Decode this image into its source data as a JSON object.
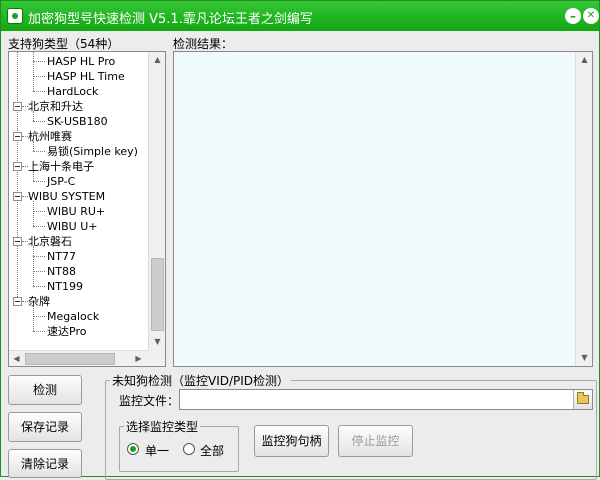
{
  "app": {
    "title": "加密狗型号快速检测 V5.1.霏凡论坛王者之剑编写",
    "minimize_glyph": "–",
    "close_glyph": "✕"
  },
  "tree": {
    "label": "支持狗类型（54种）",
    "rows": [
      {
        "text": "HASP HL Pro",
        "level": 1
      },
      {
        "text": "HASP HL Time",
        "level": 1
      },
      {
        "text": "HardLock",
        "level": 1
      },
      {
        "text": "北京和升达",
        "level": 0
      },
      {
        "text": "SK-USB180",
        "level": 1
      },
      {
        "text": "杭州唯赛",
        "level": 0
      },
      {
        "text": "易锁(Simple key)",
        "level": 1
      },
      {
        "text": "上海十条电子",
        "level": 0
      },
      {
        "text": "JSP-C",
        "level": 1
      },
      {
        "text": "WIBU SYSTEM",
        "level": 0
      },
      {
        "text": "WIBU RU+",
        "level": 1
      },
      {
        "text": "WIBU U+",
        "level": 1
      },
      {
        "text": "北京磐石",
        "level": 0
      },
      {
        "text": "NT77",
        "level": 1
      },
      {
        "text": "NT88",
        "level": 1
      },
      {
        "text": "NT199",
        "level": 1
      },
      {
        "text": "杂牌",
        "level": 0
      },
      {
        "text": "Megalock",
        "level": 1
      },
      {
        "text": "速达Pro",
        "level": 1
      }
    ]
  },
  "result": {
    "label": "检测结果："
  },
  "actions": {
    "detect": "检测",
    "save": "保存记录",
    "clear": "清除记录"
  },
  "monitor": {
    "group_title": "未知狗检测（监控VID/PID检测）",
    "file_label": "监控文件：",
    "file_value": "",
    "type_group_title": "选择监控类型",
    "single": "单一",
    "all": "全部",
    "monitor_handle": "监控狗句柄",
    "stop_monitor": "停止监控"
  },
  "colors": {
    "titlebar": "#19a319",
    "result_bg": "#f0fafa",
    "window_bg": "#ececec"
  }
}
